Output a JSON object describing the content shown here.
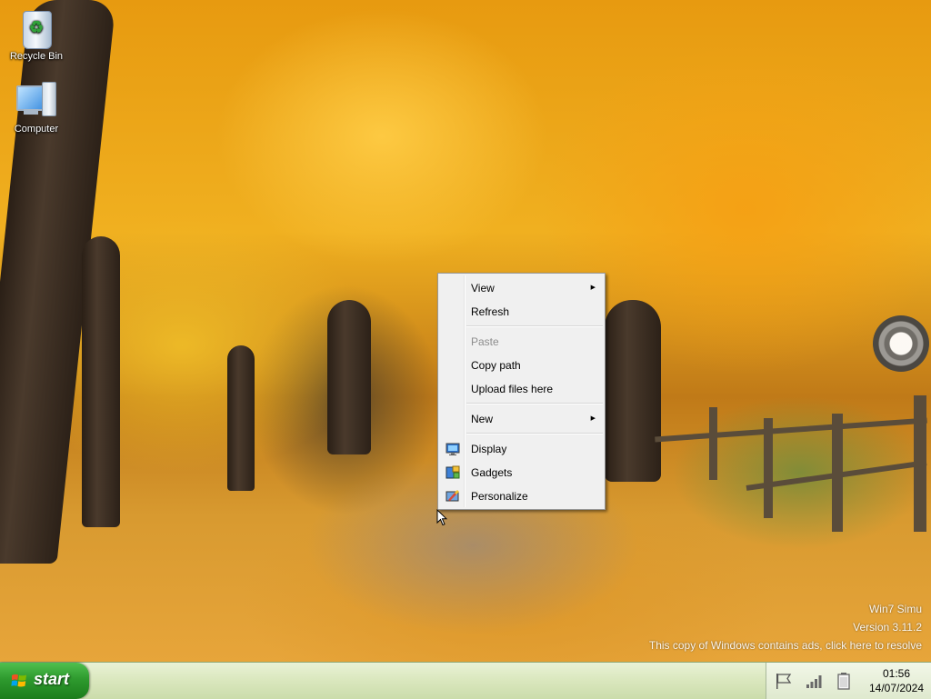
{
  "desktop": {
    "icons": [
      {
        "label": "Recycle Bin",
        "icon": "recycle-bin-icon"
      },
      {
        "label": "Computer",
        "icon": "computer-icon"
      }
    ],
    "watermark": {
      "line1": "Win7 Simu",
      "line2": "Version 3.11.2",
      "line3": "This copy of Windows contains ads, click here to resolve"
    }
  },
  "context_menu": {
    "items": [
      {
        "label": "View",
        "submenu": true
      },
      {
        "label": "Refresh"
      },
      {
        "label": "Paste",
        "disabled": true
      },
      {
        "label": "Copy path"
      },
      {
        "label": "Upload files here"
      },
      {
        "label": "New",
        "submenu": true
      },
      {
        "label": "Display",
        "icon": "display-icon"
      },
      {
        "label": "Gadgets",
        "icon": "gadgets-icon"
      },
      {
        "label": "Personalize",
        "icon": "personalize-icon"
      }
    ]
  },
  "taskbar": {
    "start_label": "start",
    "tray_icons": [
      "action-center-flag-icon",
      "network-signal-icon",
      "battery-icon"
    ],
    "clock": {
      "time": "01:56",
      "date": "14/07/2024"
    }
  },
  "colors": {
    "start_green": "#2e9a2e",
    "taskbar": "#dbe8bf",
    "menu_background": "#f0f0f0"
  }
}
